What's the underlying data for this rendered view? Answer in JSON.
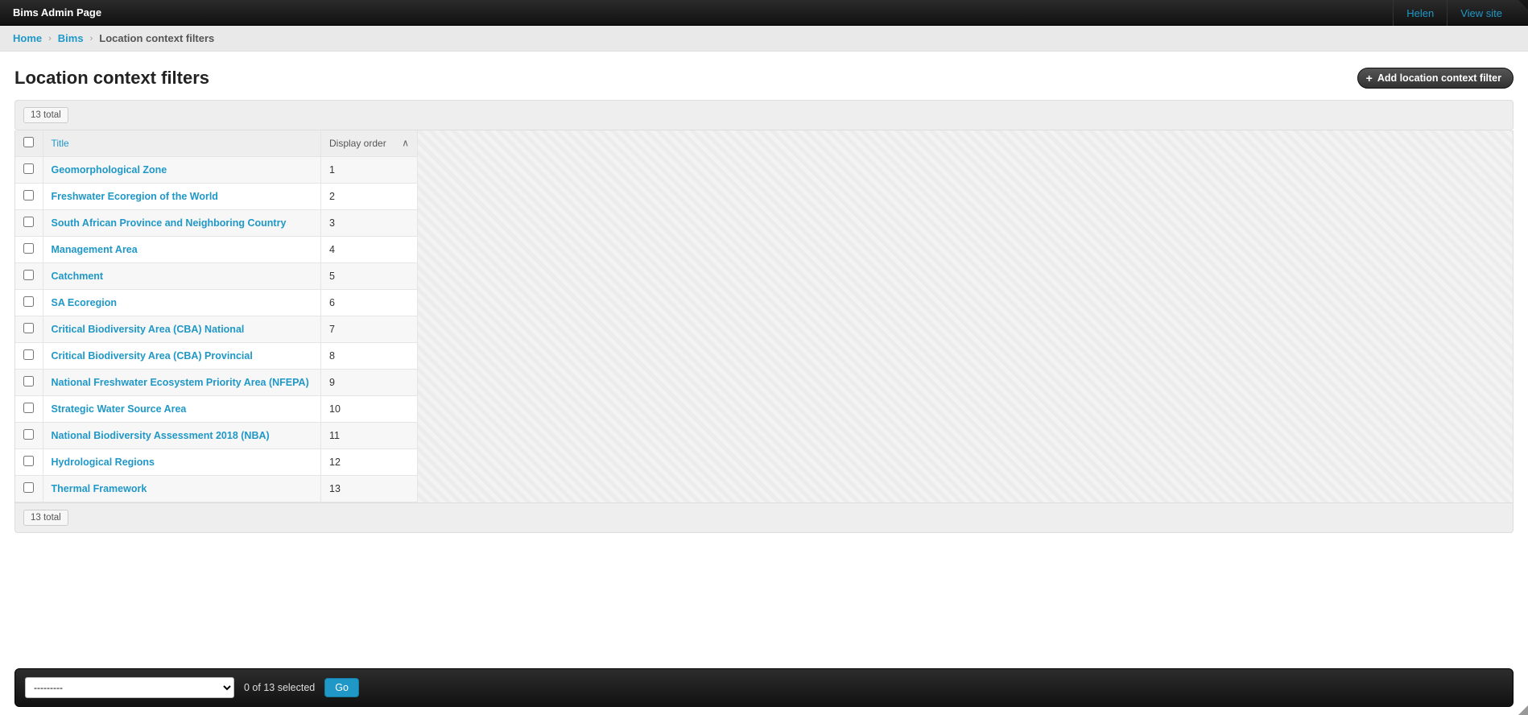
{
  "navbar": {
    "brand": "Bims Admin Page",
    "user": "Helen",
    "view_site": "View site"
  },
  "breadcrumbs": {
    "home": "Home",
    "app": "Bims",
    "current": "Location context filters"
  },
  "header": {
    "title": "Location context filters",
    "add_label": "Add location context filter"
  },
  "count_label": "13 total",
  "columns": {
    "title": "Title",
    "display_order": "Display order"
  },
  "rows": [
    {
      "title": "Geomorphological Zone",
      "order": "1"
    },
    {
      "title": "Freshwater Ecoregion of the World",
      "order": "2"
    },
    {
      "title": "South African Province and Neighboring Country",
      "order": "3"
    },
    {
      "title": "Management Area",
      "order": "4"
    },
    {
      "title": "Catchment",
      "order": "5"
    },
    {
      "title": "SA Ecoregion",
      "order": "6"
    },
    {
      "title": "Critical Biodiversity Area (CBA) National",
      "order": "7"
    },
    {
      "title": "Critical Biodiversity Area (CBA) Provincial",
      "order": "8"
    },
    {
      "title": "National Freshwater Ecosystem Priority Area (NFEPA)",
      "order": "9"
    },
    {
      "title": "Strategic Water Source Area",
      "order": "10"
    },
    {
      "title": "National Biodiversity Assessment 2018 (NBA)",
      "order": "11"
    },
    {
      "title": "Hydrological Regions",
      "order": "12"
    },
    {
      "title": "Thermal Framework",
      "order": "13"
    }
  ],
  "action_bar": {
    "placeholder_option": "---------",
    "selection_text": "0 of 13 selected",
    "go_label": "Go"
  }
}
